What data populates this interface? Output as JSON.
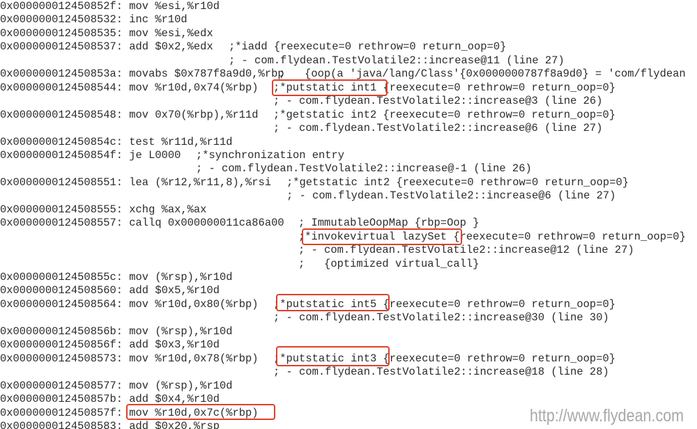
{
  "highlight_color": "#e0402a",
  "lines": [
    {
      "code": "0x000000012450852f: mov %esi,%r10d",
      "comment": ""
    },
    {
      "code": "0x0000000124508532: inc %r10d",
      "comment": ""
    },
    {
      "code": "0x0000000124508535: mov %esi,%edx",
      "comment": ""
    },
    {
      "code": "0x0000000124508537: add $0x2,%edx",
      "comment": ";*iadd {reexecute=0 rethrow=0 return_oop=0}"
    },
    {
      "code": "",
      "comment": "; - com.flydean.TestVolatile2::increase@11 (line 27)"
    },
    {
      "code": "0x000000012450853a: movabs $0x787f8a9d0,%rbp",
      "comment": ";   {oop(a 'java/lang/Class'{0x0000000787f8a9d0} = 'com/flydean"
    },
    {
      "code": "0x0000000124508544: mov %r10d,0x74(%rbp)",
      "comment": ";*putstatic int1 {reexecute=0 rethrow=0 return_oop=0}"
    },
    {
      "code": "",
      "comment": "; - com.flydean.TestVolatile2::increase@3 (line 26)"
    },
    {
      "code": "0x0000000124508548: mov 0x70(%rbp),%r11d",
      "comment": ";*getstatic int2 {reexecute=0 rethrow=0 return_oop=0}"
    },
    {
      "code": "",
      "comment": "; - com.flydean.TestVolatile2::increase@6 (line 27)"
    },
    {
      "code": "0x000000012450854c: test %r11d,%r11d",
      "comment": ""
    },
    {
      "code": "0x000000012450854f: je L0000",
      "comment": ";*synchronization entry"
    },
    {
      "code": "",
      "comment": "; - com.flydean.TestVolatile2::increase@-1 (line 26)"
    },
    {
      "code": "0x0000000124508551: lea (%r12,%r11,8),%rsi",
      "comment": ";*getstatic int2 {reexecute=0 rethrow=0 return_oop=0}"
    },
    {
      "code": "",
      "comment": "; - com.flydean.TestVolatile2::increase@6 (line 27)"
    },
    {
      "code": "0x0000000124508555: xchg %ax,%ax",
      "comment": ""
    },
    {
      "code": "0x0000000124508557: callq 0x000000011ca86a00",
      "comment": "; ImmutableOopMap {rbp=Oop }"
    },
    {
      "code": "",
      "comment": ";*invokevirtual lazySet {reexecute=0 rethrow=0 return_oop=0}"
    },
    {
      "code": "",
      "comment": "; - com.flydean.TestVolatile2::increase@12 (line 27)"
    },
    {
      "code": "",
      "comment": ";   {optimized virtual_call}"
    },
    {
      "code": "0x000000012450855c: mov (%rsp),%r10d",
      "comment": ""
    },
    {
      "code": "0x0000000124508560: add $0x5,%r10d",
      "comment": ""
    },
    {
      "code": "0x0000000124508564: mov %r10d,0x80(%rbp)",
      "comment": ";*putstatic int5 {reexecute=0 rethrow=0 return_oop=0}"
    },
    {
      "code": "",
      "comment": "; - com.flydean.TestVolatile2::increase@30 (line 30)"
    },
    {
      "code": "0x000000012450856b: mov (%rsp),%r10d",
      "comment": ""
    },
    {
      "code": "0x000000012450856f: add $0x3,%r10d",
      "comment": ""
    },
    {
      "code": "0x0000000124508573: mov %r10d,0x78(%rbp)",
      "comment": ";*putstatic int3 {reexecute=0 rethrow=0 return_oop=0}"
    },
    {
      "code": "",
      "comment": "; - com.flydean.TestVolatile2::increase@18 (line 28)"
    },
    {
      "code": "0x0000000124508577: mov (%rsp),%r10d",
      "comment": ""
    },
    {
      "code": "0x000000012450857b: add $0x4,%r10d",
      "comment": ""
    },
    {
      "code": "0x000000012450857f: mov %r10d,0x7c(%rbp)",
      "comment": ""
    },
    {
      "code": "0x0000000124508583: add $0x20,%rsp",
      "comment": ""
    }
  ],
  "watermark": "http://www.flydean.com"
}
